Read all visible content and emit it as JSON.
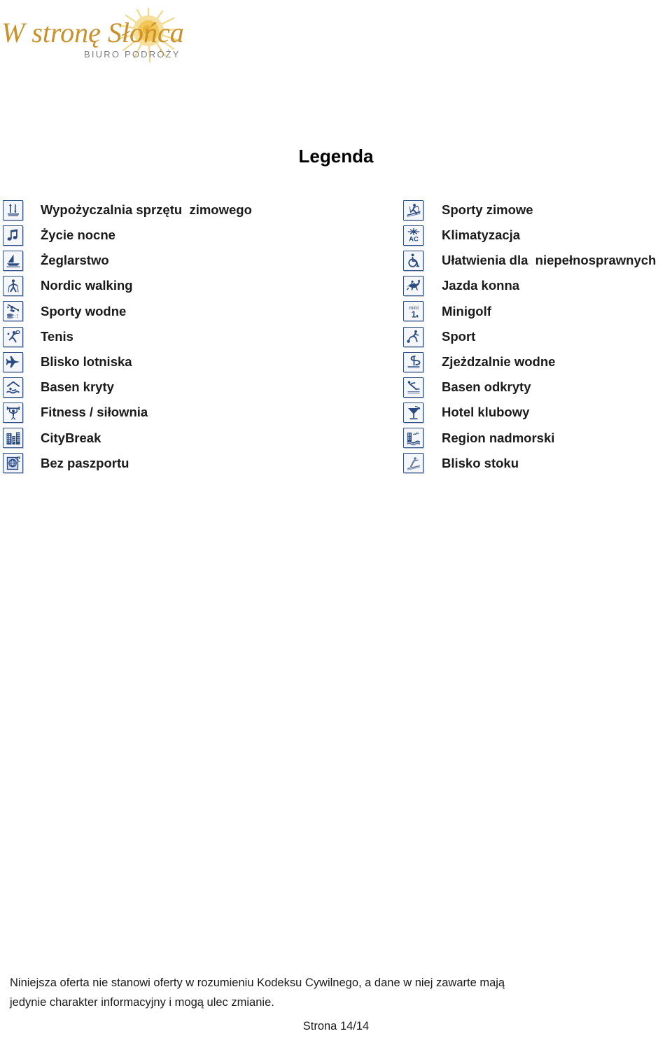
{
  "brand": {
    "name": "W stronę Słońca",
    "tagline": "BIURO PODRÓŻY",
    "colors": {
      "word_mark": "#C8912B",
      "tagline": "#7a7a7a",
      "sun_core": "#F2C14B",
      "sun_rays": "#F4D98B"
    }
  },
  "page": {
    "title": "Legenda",
    "background": "#ffffff",
    "icon_border_color": "#2a4a82",
    "icon_fill_color": "#2a4a82",
    "text_color": "#1a1a1a"
  },
  "legend": {
    "left_column": [
      {
        "icon": "ski-rental-icon",
        "label": "Wypożyczalnia sprzętu  zimowego"
      },
      {
        "icon": "music-note-icon",
        "label": "Życie nocne"
      },
      {
        "icon": "sailboat-icon",
        "label": "Żeglarstwo"
      },
      {
        "icon": "nordic-walking-icon",
        "label": "Nordic walking"
      },
      {
        "icon": "kayak-icon",
        "label": "Sporty wodne"
      },
      {
        "icon": "tennis-icon",
        "label": "Tenis"
      },
      {
        "icon": "airplane-icon",
        "label": "Blisko lotniska"
      },
      {
        "icon": "indoor-pool-icon",
        "label": "Basen kryty"
      },
      {
        "icon": "weightlifter-icon",
        "label": "Fitness / siłownia"
      },
      {
        "icon": "city-buildings-icon",
        "label": "CityBreak"
      },
      {
        "icon": "passport-globe-icon",
        "label": "Bez paszportu"
      }
    ],
    "right_column": [
      {
        "icon": "cross-country-ski-icon",
        "label": "Sporty zimowe"
      },
      {
        "icon": "air-conditioning-icon",
        "label": "Klimatyzacja"
      },
      {
        "icon": "wheelchair-icon",
        "label": "Ułatwienia dla  niepełnosprawnych"
      },
      {
        "icon": "horse-riding-icon",
        "label": "Jazda konna"
      },
      {
        "icon": "minigolf-icon",
        "label": "Minigolf"
      },
      {
        "icon": "football-player-icon",
        "label": "Sport"
      },
      {
        "icon": "water-slide-icon",
        "label": "Zjeżdzalnie wodne"
      },
      {
        "icon": "diving-board-icon",
        "label": "Basen odkryty"
      },
      {
        "icon": "cocktail-glass-icon",
        "label": "Hotel klubowy"
      },
      {
        "icon": "seaside-region-icon",
        "label": "Region nadmorski"
      },
      {
        "icon": "near-slope-icon",
        "label": "Blisko stoku"
      }
    ]
  },
  "footer": {
    "disclaimer_line1": "Niniejsza oferta nie stanowi oferty w rozumieniu Kodeksu Cywilnego, a dane w niej zawarte mają",
    "disclaimer_line2": "jedynie charakter informacyjny i mogą ulec zmianie.",
    "page_number": "Strona 14/14"
  }
}
